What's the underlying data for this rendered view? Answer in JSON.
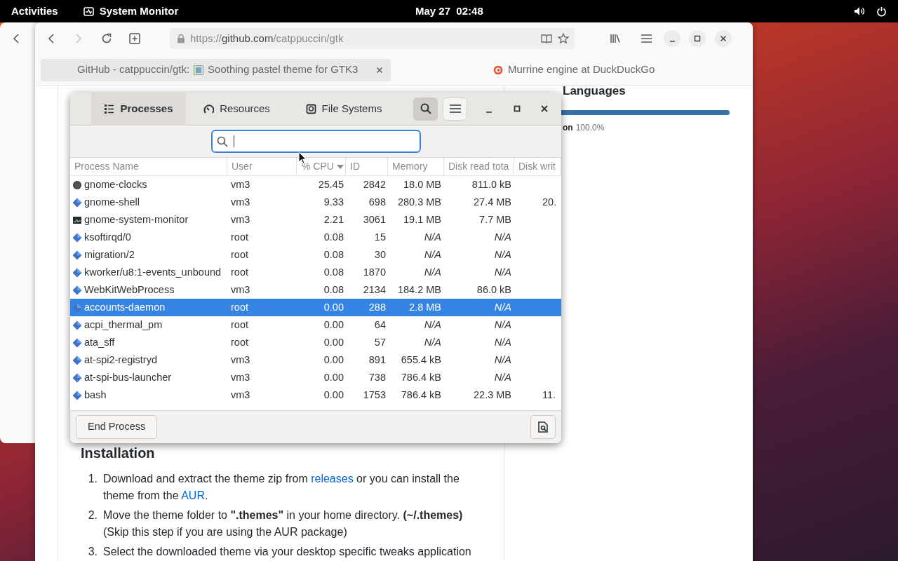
{
  "top_bar": {
    "activities": "Activities",
    "app": "System Monitor",
    "clock": "May 27  02:48"
  },
  "browser": {
    "url_scheme": "https://",
    "url_host": "github.com",
    "url_path": "/catppuccin/gtk",
    "forward_disabled": true,
    "tabs": [
      {
        "title": "GitHub - catppuccin/gtk:",
        "title_after_icon": "Soothing pastel theme for GTK3",
        "selected": true
      },
      {
        "title": "Murrine engine at DuckDuckGo",
        "selected": false
      }
    ]
  },
  "page": {
    "sidebar": {
      "heading": "Languages",
      "languages": [
        {
          "name": "on",
          "percent": "100.0%",
          "level": 1.0
        }
      ]
    },
    "section": {
      "heading": "Installation",
      "steps": [
        {
          "number": "1.",
          "segments": [
            {
              "kind": "text",
              "text": "Download and extract the theme zip from "
            },
            {
              "kind": "link",
              "text": "releases"
            },
            {
              "kind": "text",
              "text": " or you can install the theme from the "
            },
            {
              "kind": "link",
              "text": "AUR"
            },
            {
              "kind": "text",
              "text": "."
            }
          ]
        },
        {
          "number": "2.",
          "segments": [
            {
              "kind": "text",
              "text": "Move the theme folder to **\".themes\"** in your home directory. **(~/.themes)**"
            },
            {
              "kind": "break"
            },
            {
              "kind": "text",
              "text": "(Skip this step if you are using the AUR package)"
            }
          ]
        },
        {
          "number": "3.",
          "segments": [
            {
              "kind": "text",
              "text": "Select the downloaded theme via your desktop specific tweaks application"
            }
          ]
        }
      ]
    }
  },
  "system_monitor": {
    "tabs": [
      {
        "label": "Processes",
        "selected": true
      },
      {
        "label": "Resources",
        "selected": false
      },
      {
        "label": "File Systems",
        "selected": false
      }
    ],
    "search_open": true,
    "columns": [
      {
        "label": "Process Name",
        "sorted": false
      },
      {
        "label": "User",
        "sorted": false
      },
      {
        "label": "% CPU",
        "sorted": true
      },
      {
        "label": "ID",
        "sorted": false
      },
      {
        "label": "Memory",
        "sorted": false
      },
      {
        "label": "Disk read tota",
        "sorted": false
      },
      {
        "label": "Disk writ",
        "sorted": false
      }
    ],
    "rows": [
      {
        "name": "gnome-clocks",
        "kind": "clock",
        "user": "vm3",
        "cpu": "25.45",
        "id": "2842",
        "memory": "18.0 MB",
        "memory_na": false,
        "disk_read": "811.0 kB",
        "disk_read_na": false,
        "selected": false
      },
      {
        "name": "gnome-shell",
        "kind": "diamond",
        "user": "vm3",
        "cpu": "9.33",
        "id": "698",
        "memory": "280.3 MB",
        "memory_na": false,
        "disk_read": "27.4 MB",
        "disk_read_na": false,
        "disk_write": "20.",
        "selected": false
      },
      {
        "name": "gnome-system-monitor",
        "kind": "monitor",
        "user": "vm3",
        "cpu": "2.21",
        "id": "3061",
        "memory": "19.1 MB",
        "memory_na": false,
        "disk_read": "7.7 MB",
        "disk_read_na": false,
        "selected": false
      },
      {
        "name": "ksoftirqd/0",
        "kind": "diamond",
        "user": "root",
        "cpu": "0.08",
        "id": "15",
        "memory": "N/A",
        "memory_na": true,
        "disk_read": "N/A",
        "disk_read_na": true,
        "selected": false
      },
      {
        "name": "migration/2",
        "kind": "diamond",
        "user": "root",
        "cpu": "0.08",
        "id": "30",
        "memory": "N/A",
        "memory_na": true,
        "disk_read": "N/A",
        "disk_read_na": true,
        "selected": false
      },
      {
        "name": "kworker/u8:1-events_unbound",
        "kind": "diamond",
        "user": "root",
        "cpu": "0.08",
        "id": "1870",
        "memory": "N/A",
        "memory_na": true,
        "disk_read": "N/A",
        "disk_read_na": true,
        "selected": false
      },
      {
        "name": "WebKitWebProcess",
        "kind": "diamond",
        "user": "vm3",
        "cpu": "0.08",
        "id": "2134",
        "memory": "184.2 MB",
        "memory_na": false,
        "disk_read": "86.0 kB",
        "disk_read_na": false,
        "selected": false
      },
      {
        "name": "accounts-daemon",
        "kind": "diamond",
        "user": "root",
        "cpu": "0.00",
        "id": "288",
        "memory": "2.8 MB",
        "memory_na": false,
        "disk_read": "N/A",
        "disk_read_na": true,
        "selected": true
      },
      {
        "name": "acpi_thermal_pm",
        "kind": "diamond",
        "user": "root",
        "cpu": "0.00",
        "id": "64",
        "memory": "N/A",
        "memory_na": true,
        "disk_read": "N/A",
        "disk_read_na": true,
        "selected": false
      },
      {
        "name": "ata_sff",
        "kind": "diamond",
        "user": "root",
        "cpu": "0.00",
        "id": "57",
        "memory": "N/A",
        "memory_na": true,
        "disk_read": "N/A",
        "disk_read_na": true,
        "selected": false
      },
      {
        "name": "at-spi2-registryd",
        "kind": "diamond",
        "user": "vm3",
        "cpu": "0.00",
        "id": "891",
        "memory": "655.4 kB",
        "memory_na": false,
        "disk_read": "N/A",
        "disk_read_na": true,
        "selected": false
      },
      {
        "name": "at-spi-bus-launcher",
        "kind": "diamond",
        "user": "vm3",
        "cpu": "0.00",
        "id": "738",
        "memory": "786.4 kB",
        "memory_na": false,
        "disk_read": "N/A",
        "disk_read_na": true,
        "selected": false
      },
      {
        "name": "bash",
        "kind": "diamond",
        "user": "vm3",
        "cpu": "0.00",
        "id": "1753",
        "memory": "786.4 kB",
        "memory_na": false,
        "disk_read": "22.3 MB",
        "disk_read_na": false,
        "disk_write": "11.",
        "selected": false
      }
    ],
    "end_button": "End Process"
  }
}
